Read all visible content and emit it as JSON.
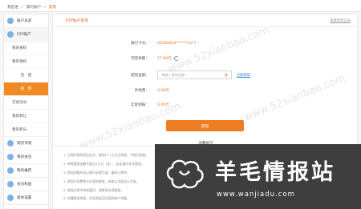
{
  "breadcrumb": {
    "items": [
      "我是谁",
      "我的账户",
      "提现"
    ],
    "separator": ">"
  },
  "sidebar": {
    "groups": [
      {
        "label": "账户总览",
        "items": []
      },
      {
        "label": "P2P账户",
        "items": [
          "我的投标",
          "我的债权",
          "充　值",
          "提　现",
          "交易流水",
          "我的转让",
          "我的积分"
        ]
      },
      {
        "label": "网贷评测",
        "items": []
      },
      {
        "label": "我的关注",
        "items": []
      },
      {
        "label": "我的推荐",
        "items": []
      },
      {
        "label": "会员权益",
        "items": []
      },
      {
        "label": "基本设置",
        "items": []
      }
    ]
  },
  "main": {
    "title": "P2P账户提现",
    "history_link": "查看提现记录",
    "fields": {
      "card_label": "银行卡号：",
      "card_value": "62284834******5277",
      "balance_label": "可提余额：",
      "balance_value": "27.00元",
      "amount_label": "提现金额：",
      "amount_placeholder": "请输入提现金额",
      "amount_unit": "元",
      "all_link": "全额提现",
      "fee_label": "手续费：",
      "fee_value": "0.00元",
      "actual_label": "实际到账：",
      "actual_value": "0.00元"
    },
    "submit_label": "提现",
    "tips_title": "温馨提示",
    "tips": [
      "1. 为保护您的资金安全，提现T+1工作日到账，节假日顺延。",
      "2. 单笔提现金额不超过5万元（含），超出请分多次提现。",
      "3. 提现到账时间以银行处理为准，请耐心等待。",
      "4. 提现手续费按平台规则收取，具体以页面显示为准。",
      "5. 提现过程中如有疑问，请联系在线客服。",
      "6. 如遇提现失败，资金将退回至您的账户余额。"
    ]
  },
  "watermark": "www.52xianbao.com",
  "banner": {
    "title": "羊毛情报站",
    "url": "www.wanjiadu.com",
    "bg_color": "#3e3e3e"
  },
  "colors": {
    "accent": "#ef7d22",
    "link": "#3a86d6",
    "sidebar_icon": "#7fb0e6"
  }
}
